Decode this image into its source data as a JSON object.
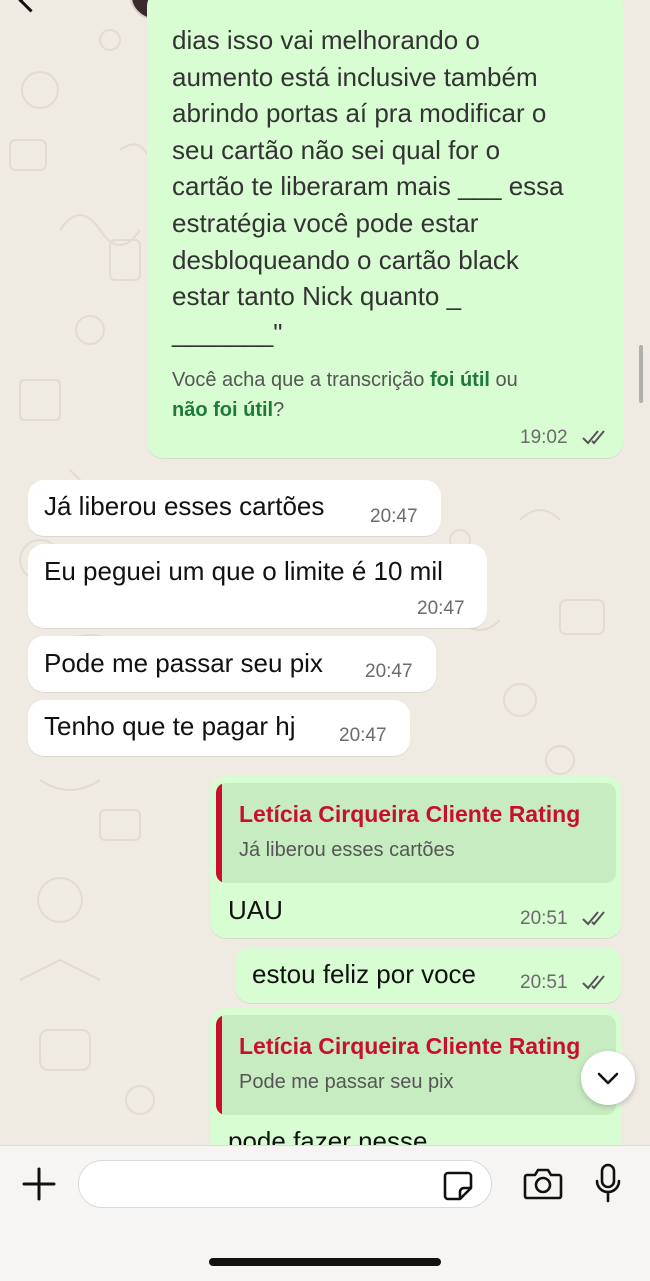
{
  "transcription": {
    "lines": [
      "dias isso vai melhorando o",
      "aumento está inclusive também",
      "abrindo portas aí pra modificar o",
      "seu cartão não sei qual for o",
      "cartão te liberaram mais ___ essa",
      "estratégia você pode estar",
      "desbloqueando o cartão black",
      "estar tanto Nick quanto _",
      "_______\""
    ],
    "question_prefix": "Você acha que a transcrição ",
    "useful": "foi útil",
    "or": " ou",
    "not_useful": "não foi útil",
    "question_suffix": "?",
    "time": "19:02"
  },
  "messages": [
    {
      "text": "Já liberou esses cartões",
      "time": "20:47"
    },
    {
      "text": "Eu peguei um que o limite é 10 mil",
      "time": "20:47"
    },
    {
      "text": "Pode me passar seu pix",
      "time": "20:47"
    },
    {
      "text": "Tenho que te pagar hj",
      "time": "20:47"
    }
  ],
  "reply1": {
    "author": "Letícia Cirqueira Cliente Rating",
    "quoted": "Já liberou esses cartões",
    "text": "UAU",
    "time": "20:51"
  },
  "sent2": {
    "text": "estou feliz por voce",
    "time": "20:51"
  },
  "reply2": {
    "author": "Letícia Cirqueira Cliente Rating",
    "quoted": "Pode me passar seu pix",
    "text": "pode fazer nesse"
  },
  "input": {
    "placeholder": ""
  },
  "colors": {
    "incoming": "#ffffff",
    "outgoing": "#d9fdd3",
    "quote_author": "#c8102e",
    "link": "#1f7a3a",
    "wallpaper": "#efeae2"
  },
  "icons": [
    "back-arrow-icon",
    "call-icon",
    "double-check-icon",
    "chevron-down-icon",
    "plus-icon",
    "sticker-icon",
    "camera-icon",
    "microphone-icon"
  ]
}
